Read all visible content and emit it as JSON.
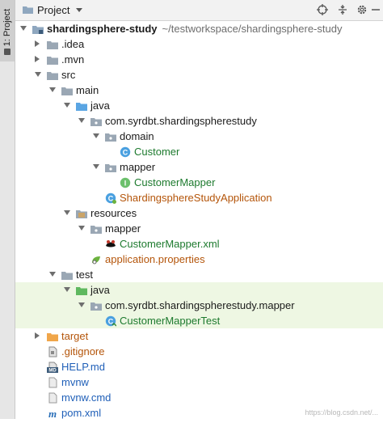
{
  "sidebar": {
    "tab_label": "1: Project"
  },
  "header": {
    "title": "Project"
  },
  "tree": [
    {
      "label": "shardingsphere-study",
      "hint": "~/testworkspace/shardingsphere-study",
      "indent": 0,
      "arrow": "down",
      "icon": "module-folder-icon",
      "color": "dark",
      "bold": true
    },
    {
      "label": ".idea",
      "indent": 1,
      "arrow": "right",
      "icon": "folder-icon",
      "color": "dark"
    },
    {
      "label": ".mvn",
      "indent": 1,
      "arrow": "right",
      "icon": "folder-icon",
      "color": "dark"
    },
    {
      "label": "src",
      "indent": 1,
      "arrow": "down",
      "icon": "folder-icon",
      "color": "dark"
    },
    {
      "label": "main",
      "indent": 2,
      "arrow": "down",
      "icon": "folder-icon",
      "color": "dark"
    },
    {
      "label": "java",
      "indent": 3,
      "arrow": "down",
      "icon": "source-folder-icon",
      "color": "dark"
    },
    {
      "label": "com.syrdbt.shardingspherestudy",
      "indent": 4,
      "arrow": "down",
      "icon": "package-icon",
      "color": "dark"
    },
    {
      "label": "domain",
      "indent": 5,
      "arrow": "down",
      "icon": "package-icon",
      "color": "dark"
    },
    {
      "label": "Customer",
      "indent": 6,
      "arrow": "none",
      "icon": "class-icon",
      "color": "green"
    },
    {
      "label": "mapper",
      "indent": 5,
      "arrow": "down",
      "icon": "package-icon",
      "color": "dark"
    },
    {
      "label": "CustomerMapper",
      "indent": 6,
      "arrow": "none",
      "icon": "interface-icon",
      "color": "green"
    },
    {
      "label": "ShardingsphereStudyApplication",
      "indent": 5,
      "arrow": "none",
      "icon": "spring-class-icon",
      "color": "orange"
    },
    {
      "label": "resources",
      "indent": 3,
      "arrow": "down",
      "icon": "resources-folder-icon",
      "color": "dark"
    },
    {
      "label": "mapper",
      "indent": 4,
      "arrow": "down",
      "icon": "package-icon",
      "color": "dark"
    },
    {
      "label": "CustomerMapper.xml",
      "indent": 5,
      "arrow": "none",
      "icon": "mybatis-xml-icon",
      "color": "green"
    },
    {
      "label": "application.properties",
      "indent": 4,
      "arrow": "none",
      "icon": "properties-icon",
      "color": "orange"
    },
    {
      "label": "test",
      "indent": 2,
      "arrow": "down",
      "icon": "folder-icon",
      "color": "dark"
    },
    {
      "label": "java",
      "indent": 3,
      "arrow": "down",
      "icon": "test-folder-icon",
      "color": "dark",
      "test": true
    },
    {
      "label": "com.syrdbt.shardingspherestudy.mapper",
      "indent": 4,
      "arrow": "down",
      "icon": "package-icon",
      "color": "dark",
      "test": true
    },
    {
      "label": "CustomerMapperTest",
      "indent": 5,
      "arrow": "none",
      "icon": "test-class-icon",
      "color": "green",
      "test": true
    },
    {
      "label": "target",
      "indent": 1,
      "arrow": "right",
      "icon": "excluded-folder-icon",
      "color": "orange"
    },
    {
      "label": ".gitignore",
      "indent": 1,
      "arrow": "none",
      "icon": "gitignore-icon",
      "color": "orange"
    },
    {
      "label": "HELP.md",
      "indent": 1,
      "arrow": "none",
      "icon": "markdown-icon",
      "color": "blue"
    },
    {
      "label": "mvnw",
      "indent": 1,
      "arrow": "none",
      "icon": "file-icon",
      "color": "blue"
    },
    {
      "label": "mvnw.cmd",
      "indent": 1,
      "arrow": "none",
      "icon": "file-icon",
      "color": "blue"
    },
    {
      "label": "pom.xml",
      "indent": 1,
      "arrow": "none",
      "icon": "maven-icon",
      "color": "blue"
    }
  ],
  "colors": {
    "dark": "#1b1b1b",
    "green": "#1d7a2e",
    "orange": "#b4550a",
    "blue": "#1f5fb8",
    "test_bg": "#eef7e3"
  },
  "watermark": "https://blog.csdn.net/..."
}
